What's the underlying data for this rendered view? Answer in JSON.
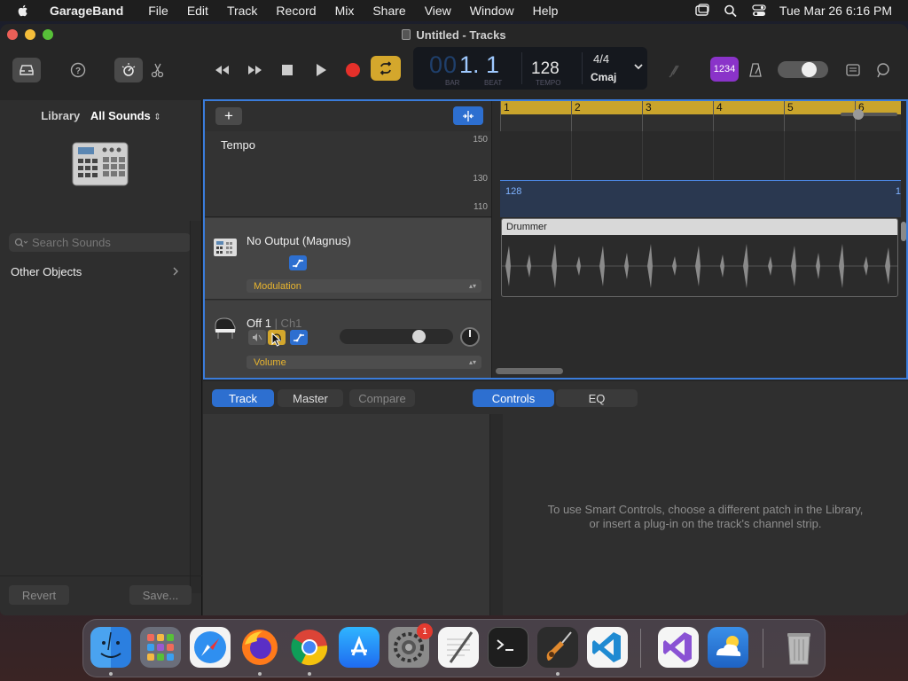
{
  "menubar": {
    "app_name": "GarageBand",
    "items": [
      "File",
      "Edit",
      "Track",
      "Record",
      "Mix",
      "Share",
      "View",
      "Window",
      "Help"
    ],
    "clock": "Tue Mar 26  6:16 PM"
  },
  "window": {
    "title": "Untitled - Tracks"
  },
  "lcd": {
    "bar_digits": "00",
    "bar_value": "1. 1",
    "bar_label": "BAR",
    "beat_label": "BEAT",
    "tempo": "128",
    "tempo_label": "TEMPO",
    "time_signature": "4/4",
    "key": "Cmaj"
  },
  "toolbar": {
    "count_in_label": "1234"
  },
  "library": {
    "label": "Library",
    "selection": "All Sounds",
    "search_placeholder": "Search Sounds",
    "row_label": "Other Objects",
    "revert_label": "Revert",
    "save_label": "Save..."
  },
  "tracks": {
    "add_label": "+",
    "tempo_track": {
      "name": "Tempo",
      "scale": [
        "150",
        "130",
        "110"
      ],
      "value_start": "128",
      "value_end": "1"
    },
    "track1": {
      "name": "No Output (Magnus)",
      "automation": "Modulation"
    },
    "track2": {
      "name": "Off 1",
      "channel": " | Ch1",
      "automation": "Volume"
    },
    "ruler_marks": [
      "1",
      "2",
      "3",
      "4",
      "5",
      "6"
    ],
    "region_name": "Drummer"
  },
  "smart_controls": {
    "tabs_left": [
      "Track",
      "Master",
      "Compare"
    ],
    "tabs_right": [
      "Controls",
      "EQ"
    ],
    "message_line1": "To use Smart Controls, choose a different patch in the Library,",
    "message_line2": "or insert a plug-in on the track's channel strip."
  },
  "dock": {
    "settings_badge": "1",
    "apps": [
      "finder-icon",
      "launchpad-icon",
      "safari-icon",
      "firefox-icon",
      "chrome-icon",
      "app-store-icon",
      "system-settings-icon",
      "textedit-icon",
      "terminal-icon",
      "garageband-icon",
      "vscode-icon",
      "visual-studio-icon",
      "weather-icon",
      "trash-icon"
    ]
  },
  "colors": {
    "accent_blue": "#2d6fd0",
    "ruler_gold": "#c9a42c",
    "count_in_purple": "#8a33c9",
    "record_red": "#e5302a",
    "cycle_gold": "#d4a72c"
  }
}
